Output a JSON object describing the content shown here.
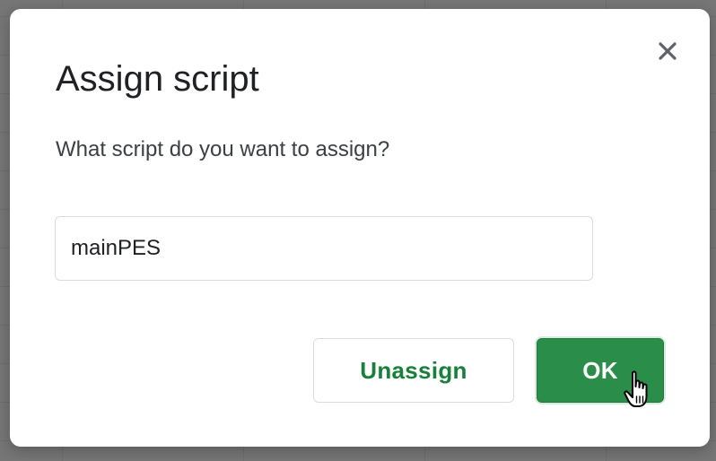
{
  "dialog": {
    "title": "Assign script",
    "prompt": "What script do you want to assign?",
    "input": {
      "value": "mainPES",
      "placeholder": ""
    },
    "buttons": {
      "unassign_label": "Unassign",
      "ok_label": "OK"
    },
    "close_icon": "close-icon"
  },
  "colors": {
    "overlay": "#767676",
    "dialog_bg": "#ffffff",
    "title_text": "#202124",
    "body_text": "#3c4043",
    "primary_green": "#2a8e4a",
    "link_green": "#188038",
    "border": "#dadce0"
  },
  "cursor": {
    "type": "pointer-hand-icon"
  }
}
